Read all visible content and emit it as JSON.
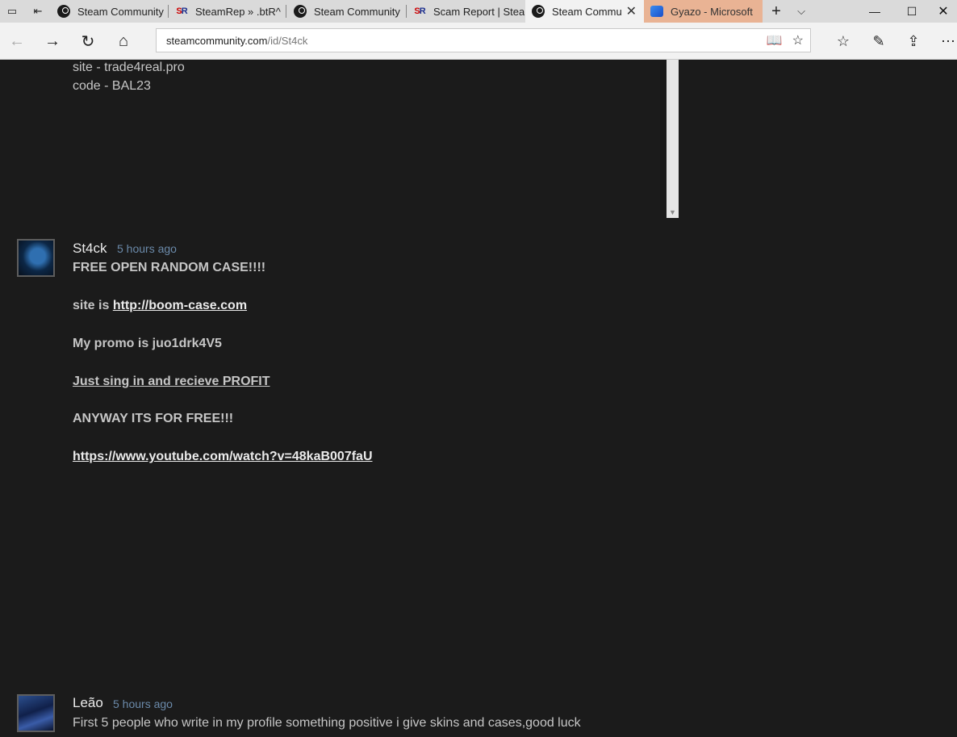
{
  "tabs": [
    {
      "label": "Steam Community",
      "icon": "steam-icon"
    },
    {
      "label": "SteamRep » .btR^",
      "icon": "steamrep-icon"
    },
    {
      "label": "Steam Community",
      "icon": "steam-icon"
    },
    {
      "label": "Scam Report | Stea",
      "icon": "steamrep-icon"
    },
    {
      "label": "Steam Commu",
      "icon": "steam-icon",
      "active": true
    },
    {
      "label": "Gyazo - Microsoft",
      "icon": "gyazo-icon"
    }
  ],
  "address": {
    "host": "steamcommunity.com",
    "path": "/id/St4ck"
  },
  "comments": {
    "prev": {
      "line1": "site - trade4real.pro",
      "line2": "code - BAL23"
    },
    "c1": {
      "author": "St4ck",
      "time": "5 hours ago",
      "l1": "FREE OPEN RANDOM CASE!!!!",
      "l2_prefix": "site is ",
      "l2_link": "http://boom-case.com",
      "l3": "My promo is juo1drk4V5",
      "l4": "Just sing in and recieve PROFIT",
      "l5": "ANYWAY ITS FOR FREE!!!",
      "l6": "https://www.youtube.com/watch?v=48kaB007faU"
    },
    "c2": {
      "author": "Leão",
      "time": "5 hours ago",
      "text": "First 5 people who write in my profile something positive i give skins and cases,good luck"
    }
  }
}
